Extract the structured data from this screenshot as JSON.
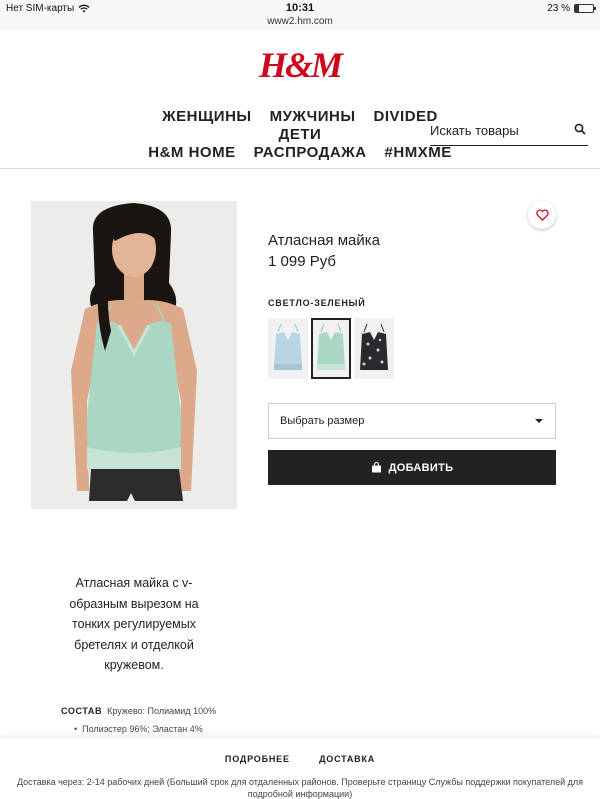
{
  "status_bar": {
    "carrier": "Нет SIM-карты",
    "time": "10:31",
    "battery": "23 %",
    "battery_level": 0.23,
    "url": "www2.hm.com"
  },
  "header": {
    "logo": "H&M",
    "nav": [
      "ЖЕНЩИНЫ",
      "МУЖЧИНЫ",
      "DIVIDED",
      "ДЕТИ",
      "H&M HOME",
      "РАСПРОДАЖА",
      "#HMXME"
    ],
    "search_placeholder": "Искать товары"
  },
  "product": {
    "title": "Атласная майка",
    "price": "1 099 Руб",
    "color_label": "СВЕТЛО-ЗЕЛЕНЫЙ",
    "swatches": [
      {
        "name": "light-blue",
        "color": "#b9d4e2"
      },
      {
        "name": "light-green",
        "color": "#a9d7c3"
      },
      {
        "name": "black-floral",
        "color": "#2a2a2e"
      }
    ],
    "selected_swatch": 1,
    "size_placeholder": "Выбрать размер",
    "add_button": "ДОБАВИТЬ"
  },
  "description": {
    "text": "Атласная майка с v-образным вырезом на тонких регулируемых бретелях и отделкой кружевом.",
    "composition_label": "СОСТАВ",
    "composition_1": "Кружево: Полиамид 100%",
    "composition_2": "Полиэстер 96%; Эластан 4%"
  },
  "bottom_bar": {
    "tabs": [
      "ПОДРОБНЕЕ",
      "ДОСТАВКА"
    ],
    "delivery_text": "Доставка через: 2-14 рабочих дней (Больший срок для отдаленных районов. Проверьте страницу Службы поддержки покупателей для подробной информации)"
  },
  "colors": {
    "brand_red": "#cc071e",
    "button_dark": "#222222",
    "product_green": "#a9d7c3"
  }
}
